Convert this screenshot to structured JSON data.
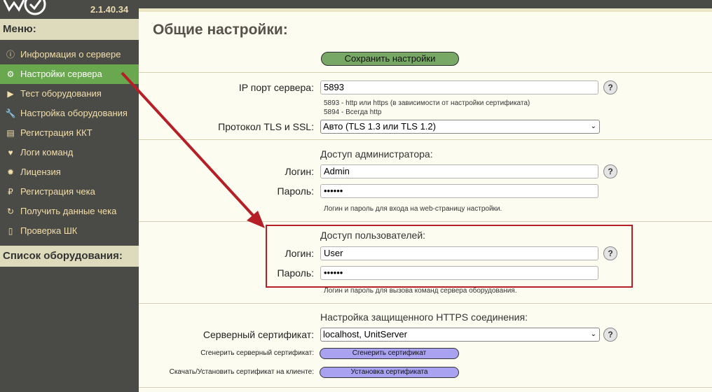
{
  "app": {
    "version": "2.1.40.34"
  },
  "sidebar": {
    "menu_title": "Меню:",
    "items": [
      {
        "label": "Информация о сервере",
        "icon": "info-icon"
      },
      {
        "label": "Настройки сервера",
        "icon": "gears-icon"
      },
      {
        "label": "Тест оборудования",
        "icon": "play-icon"
      },
      {
        "label": "Настройка оборудования",
        "icon": "wrench-icon"
      },
      {
        "label": "Регистрация ККТ",
        "icon": "register-icon"
      },
      {
        "label": "Логи команд",
        "icon": "heartbeat-icon"
      },
      {
        "label": "Лицензия",
        "icon": "certificate-icon"
      },
      {
        "label": "Регистрация чека",
        "icon": "ruble-icon"
      },
      {
        "label": "Получить данные чека",
        "icon": "refresh-icon"
      },
      {
        "label": "Проверка ШК",
        "icon": "barcode-icon"
      }
    ],
    "equipment_title": "Список оборудования:"
  },
  "main": {
    "title": "Общие настройки:",
    "save_button": "Сохранить настройки",
    "ip_port": {
      "label": "IP порт сервера:",
      "value": "5893",
      "hint_1": "5893 - http или https (в зависимости от настройки сертификата)",
      "hint_2": "5894 - Всегда http"
    },
    "tls": {
      "label": "Протокол TLS и SSL:",
      "value": "Авто (TLS 1.3 или TLS 1.2)"
    },
    "admin": {
      "header": "Доступ администратора:",
      "login_label": "Логин:",
      "login_value": "Admin",
      "password_label": "Пароль:",
      "password_value": "••••••",
      "hint": "Логин и пароль для входа на web-страницу настройки."
    },
    "users": {
      "header": "Доступ пользователей:",
      "login_label": "Логин:",
      "login_value": "User",
      "password_label": "Пароль:",
      "password_value": "••••••",
      "hint": "Логин и пароль для вызова команд сервера оборудования."
    },
    "https": {
      "header": "Настройка защищенного HTTPS соединения:",
      "cert_label": "Серверный сертификат:",
      "cert_value": "localhost, UnitServer",
      "generate_label": "Сгенерить серверный сертификат:",
      "generate_button": "Сгенерить сертификат",
      "install_label": "Скачать/Установить сертификат на клиенте:",
      "install_button": "Установка сертификата"
    },
    "help_glyph": "?"
  },
  "colors": {
    "sidebar_bg": "#4a4a47",
    "menu_text": "#f3dfa9",
    "active_item": "#6aa84f",
    "save_button": "#78a865",
    "cert_button": "#a9a2f0",
    "annotation": "#b51f25"
  }
}
